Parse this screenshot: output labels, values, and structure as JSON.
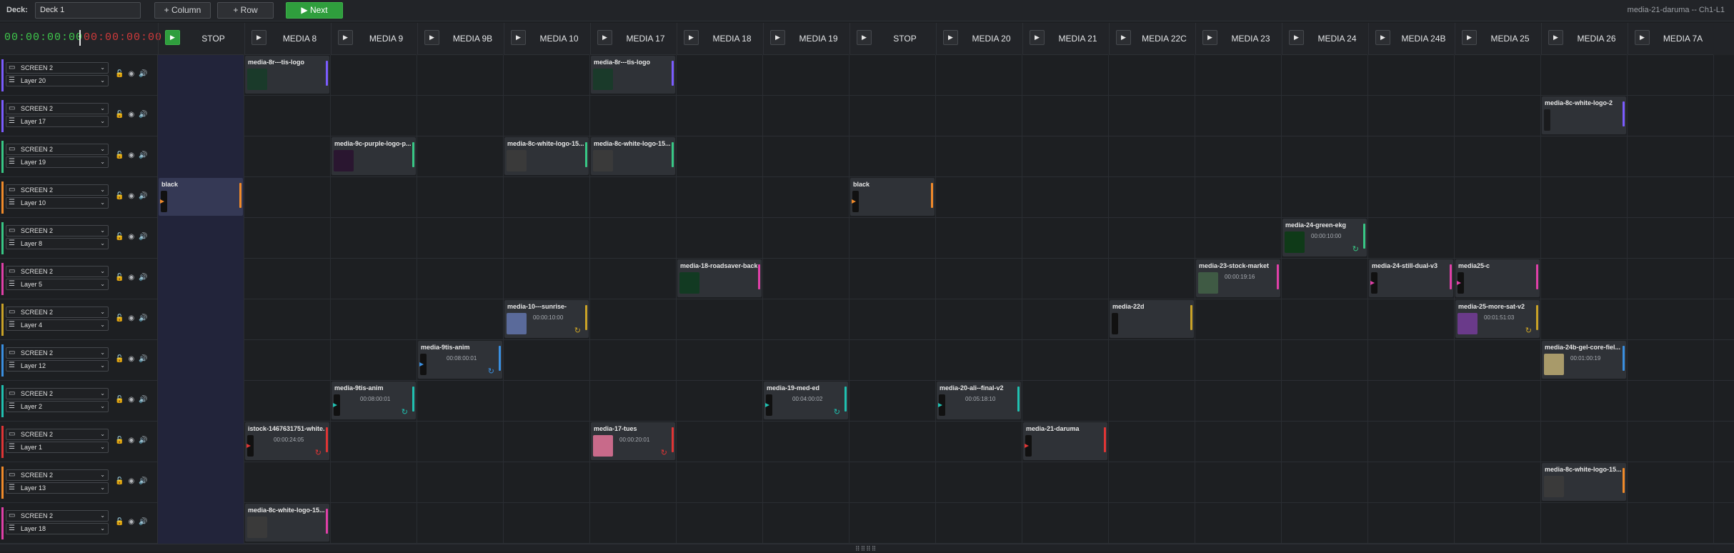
{
  "topbar": {
    "deck_label": "Deck:",
    "deck_value": "Deck 1",
    "add_column": "+ Column",
    "add_row": "+ Row",
    "next": "▶ Next",
    "status": "media-21-daruma -- Ch1-L1"
  },
  "timecode": {
    "elapsed": "00:00:00:00",
    "remaining": "00:00:00:00"
  },
  "columns": [
    "STOP",
    "MEDIA 8",
    "MEDIA 9",
    "MEDIA 9B",
    "MEDIA 10",
    "MEDIA 17",
    "MEDIA 18",
    "MEDIA 19",
    "STOP",
    "MEDIA 20",
    "MEDIA 21",
    "MEDIA 22C",
    "MEDIA 23",
    "MEDIA 24",
    "MEDIA 24B",
    "MEDIA 25",
    "MEDIA 26",
    "MEDIA 7A"
  ],
  "layers": [
    {
      "screen": "SCREEN 2",
      "layer": "Layer 20",
      "color": "#7b5cff"
    },
    {
      "screen": "SCREEN 2",
      "layer": "Layer 17",
      "color": "#7b5cff"
    },
    {
      "screen": "SCREEN 2",
      "layer": "Layer 19",
      "color": "#38c785"
    },
    {
      "screen": "SCREEN 2",
      "layer": "Layer 10",
      "color": "#f08a2a"
    },
    {
      "screen": "SCREEN 2",
      "layer": "Layer 8",
      "color": "#38c785"
    },
    {
      "screen": "SCREEN 2",
      "layer": "Layer 5",
      "color": "#e040a8"
    },
    {
      "screen": "SCREEN 2",
      "layer": "Layer 4",
      "color": "#c9a227"
    },
    {
      "screen": "SCREEN 2",
      "layer": "Layer 12",
      "color": "#3a8fe0"
    },
    {
      "screen": "SCREEN 2",
      "layer": "Layer 2",
      "color": "#20c0b0"
    },
    {
      "screen": "SCREEN 2",
      "layer": "Layer 1",
      "color": "#e03535"
    },
    {
      "screen": "SCREEN 2",
      "layer": "Layer 13",
      "color": "#f08a2a"
    },
    {
      "screen": "SCREEN 2",
      "layer": "Layer 18",
      "color": "#e040a8"
    }
  ],
  "clips": [
    {
      "row": 0,
      "col": 1,
      "title": "media-8r---tis-logo",
      "duration": "",
      "thumb": "#1a3a2a",
      "loop": false,
      "arrow": false
    },
    {
      "row": 0,
      "col": 5,
      "title": "media-8r---tis-logo",
      "duration": "",
      "thumb": "#1a3a2a",
      "loop": false,
      "arrow": false
    },
    {
      "row": 1,
      "col": 16,
      "title": "media-8c-white-logo-2",
      "duration": "",
      "thumb": "#1a1b1d",
      "loop": false,
      "arrow": false,
      "small": true
    },
    {
      "row": 2,
      "col": 2,
      "title": "media-9c-purple-logo-p...",
      "duration": "",
      "thumb": "#2a1630",
      "loop": false,
      "arrow": false
    },
    {
      "row": 2,
      "col": 4,
      "title": "media-8c-white-logo-15...",
      "duration": "",
      "thumb": "#3a3a3a",
      "loop": false,
      "arrow": false
    },
    {
      "row": 2,
      "col": 5,
      "title": "media-8c-white-logo-15...",
      "duration": "",
      "thumb": "#3a3a3a",
      "loop": false,
      "arrow": false
    },
    {
      "row": 3,
      "col": 0,
      "title": "black",
      "duration": "",
      "thumb": "#111",
      "loop": false,
      "arrow": true,
      "small": true
    },
    {
      "row": 3,
      "col": 8,
      "title": "black",
      "duration": "",
      "thumb": "#111",
      "loop": false,
      "arrow": true,
      "small": true
    },
    {
      "row": 4,
      "col": 13,
      "title": "media-24-green-ekg",
      "duration": "00:00:10:00",
      "thumb": "#0f3a18",
      "loop": true,
      "arrow": false
    },
    {
      "row": 5,
      "col": 6,
      "title": "media-18-roadsaver-back",
      "duration": "",
      "thumb": "#123a22",
      "loop": false,
      "arrow": false
    },
    {
      "row": 5,
      "col": 12,
      "title": "media-23-stock-market",
      "duration": "00:00:19:16",
      "thumb": "#3f5a44",
      "loop": false,
      "arrow": false
    },
    {
      "row": 5,
      "col": 14,
      "title": "media-24-still-dual-v3",
      "duration": "",
      "thumb": "#111",
      "loop": false,
      "arrow": true,
      "small": true
    },
    {
      "row": 5,
      "col": 15,
      "title": "media25-c",
      "duration": "",
      "thumb": "#111",
      "loop": false,
      "arrow": true,
      "small": true
    },
    {
      "row": 6,
      "col": 4,
      "title": "media-10---sunrise-",
      "duration": "00:00:10:00",
      "thumb": "#5a6a9a",
      "loop": true,
      "arrow": false
    },
    {
      "row": 6,
      "col": 11,
      "title": "media-22d",
      "duration": "",
      "thumb": "#111",
      "loop": false,
      "arrow": false,
      "small": true
    },
    {
      "row": 6,
      "col": 15,
      "title": "media-25-more-sat-v2",
      "duration": "00:01:51:03",
      "thumb": "#6a3a8a",
      "loop": true,
      "arrow": false
    },
    {
      "row": 7,
      "col": 3,
      "title": "media-9tis-anim",
      "duration": "00:08:00:01",
      "thumb": "#111",
      "loop": true,
      "arrow": true,
      "small": true
    },
    {
      "row": 7,
      "col": 16,
      "title": "media-24b-gel-core-fiel...",
      "duration": "00:01:00:19",
      "thumb": "#a89a6a",
      "loop": false,
      "arrow": false
    },
    {
      "row": 8,
      "col": 2,
      "title": "media-9tis-anim",
      "duration": "00:08:00:01",
      "thumb": "#111",
      "loop": true,
      "arrow": true,
      "small": true
    },
    {
      "row": 8,
      "col": 7,
      "title": "media-19-med-ed",
      "duration": "00:04:00:02",
      "thumb": "#111",
      "loop": true,
      "arrow": true,
      "small": true
    },
    {
      "row": 8,
      "col": 9,
      "title": "media-20-ali--final-v2",
      "duration": "00:05:18:10",
      "thumb": "#111",
      "loop": false,
      "arrow": true,
      "small": true
    },
    {
      "row": 9,
      "col": 1,
      "title": "istock-1467631751-white...",
      "duration": "00:00:24:05",
      "thumb": "#111",
      "loop": true,
      "arrow": true,
      "small": true
    },
    {
      "row": 9,
      "col": 5,
      "title": "media-17-tues",
      "duration": "00:00:20:01",
      "thumb": "#c86a8a",
      "loop": true,
      "arrow": false
    },
    {
      "row": 9,
      "col": 10,
      "title": "media-21-daruma",
      "duration": "",
      "thumb": "#111",
      "loop": false,
      "arrow": true,
      "small": true
    },
    {
      "row": 10,
      "col": 16,
      "title": "media-8c-white-logo-15...",
      "duration": "",
      "thumb": "#3a3a3a",
      "loop": false,
      "arrow": false
    },
    {
      "row": 11,
      "col": 1,
      "title": "media-8c-white-logo-15...",
      "duration": "",
      "thumb": "#3a3a3a",
      "loop": false,
      "arrow": false
    }
  ]
}
